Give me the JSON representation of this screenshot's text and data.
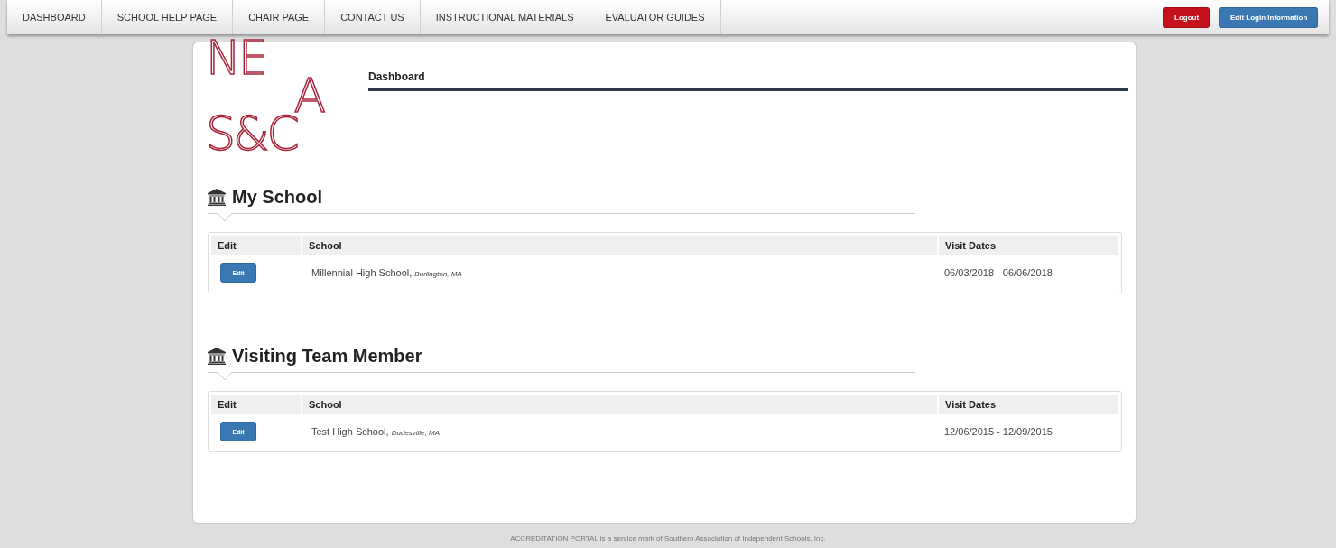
{
  "nav": {
    "items": [
      {
        "label": "DASHBOARD",
        "selected": false
      },
      {
        "label": "SCHOOL HELP PAGE",
        "selected": false
      },
      {
        "label": "CHAIR PAGE",
        "selected": false
      },
      {
        "label": "CONTACT US",
        "selected": false
      },
      {
        "label": "INSTRUCTIONAL MATERIALS",
        "selected": false
      },
      {
        "label": "EVALUATOR GUIDES",
        "selected": false
      }
    ],
    "actions": [
      {
        "label": "Logout",
        "kind": "danger"
      },
      {
        "label": "Edit Login Information",
        "kind": "primary"
      }
    ]
  },
  "logo": {
    "lines": [
      "NE",
      "A",
      "S&C"
    ]
  },
  "page_title": "Dashboard",
  "sections": [
    {
      "title": "My School",
      "columns": [
        "Edit",
        "School",
        "Visit Dates"
      ],
      "rows": [
        {
          "button": "Edit",
          "school": "Millennial High School,",
          "location": "Burlington, MA",
          "dates": "06/03/2018 - 06/06/2018"
        }
      ]
    },
    {
      "title": "Visiting Team Member",
      "columns": [
        "Edit",
        "School",
        "Visit Dates"
      ],
      "rows": [
        {
          "button": "Edit",
          "school": "Test High School,",
          "location": "Dudesville, MA",
          "dates": "12/06/2015 - 12/09/2015"
        }
      ]
    }
  ],
  "footer": "ACCREDITATION PORTAL is a service mark of Southern Association of Independent Schools, Inc."
}
